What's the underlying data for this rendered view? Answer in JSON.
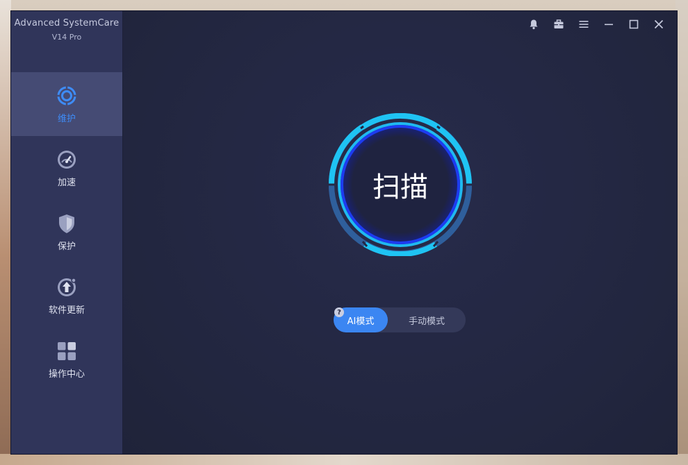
{
  "app": {
    "title": "Advanced SystemCare",
    "version": "V14 Pro"
  },
  "colors": {
    "accent": "#3b86f2",
    "active_nav_text": "#3e8cf7",
    "ring_cyan": "#1fc3f3",
    "ring_blue": "#1d3cf0"
  },
  "sidebar": {
    "items": [
      {
        "label": "维护",
        "icon": "maintenance-icon",
        "active": true
      },
      {
        "label": "加速",
        "icon": "speedometer-icon",
        "active": false
      },
      {
        "label": "保护",
        "icon": "shield-icon",
        "active": false
      },
      {
        "label": "软件更新",
        "icon": "update-arrow-icon",
        "active": false
      },
      {
        "label": "操作中心",
        "icon": "grid-icon",
        "active": false
      }
    ]
  },
  "titlebar": {
    "icons": [
      "bell-icon",
      "toolbox-icon",
      "menu-icon",
      "minimize-icon",
      "maximize-icon",
      "close-icon"
    ]
  },
  "main": {
    "scan_label": "扫描",
    "help_symbol": "?",
    "modes": {
      "ai_label": "AI模式",
      "manual_label": "手动模式",
      "selected": "ai"
    }
  }
}
